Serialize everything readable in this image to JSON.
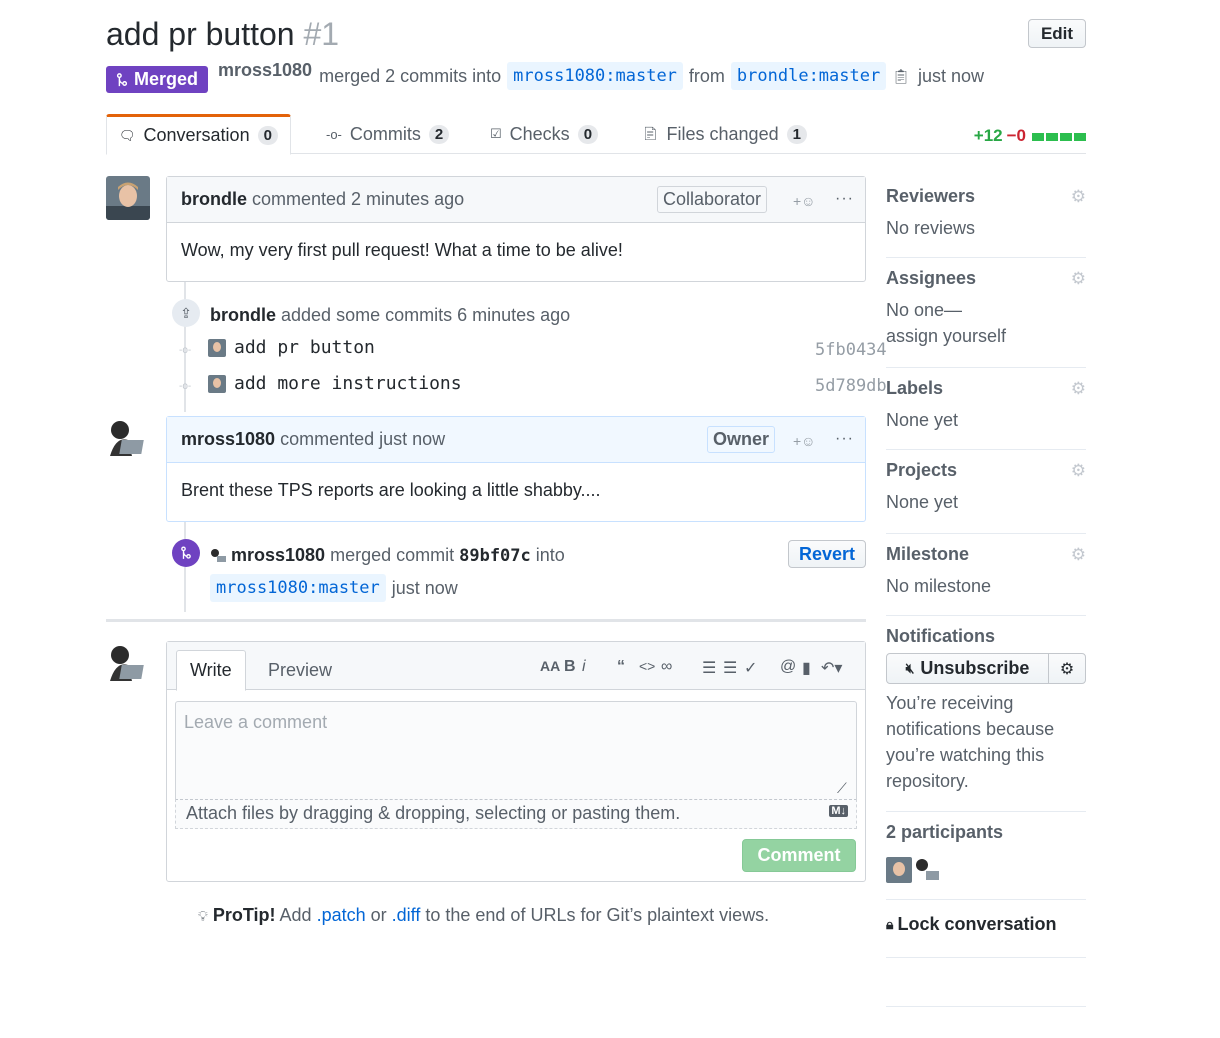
{
  "pr": {
    "title": "add pr button",
    "number": "#1",
    "edit_label": "Edit",
    "state_label": "Merged",
    "merger": "mross1080",
    "merged_text": "merged 2 commits into",
    "base_branch": "mross1080:master",
    "from_text": "from",
    "head_branch": "brondle:master",
    "time": "just now"
  },
  "tabs": [
    {
      "label": "Conversation",
      "count": "0"
    },
    {
      "label": "Commits",
      "count": "2"
    },
    {
      "label": "Checks",
      "count": "0"
    },
    {
      "label": "Files changed",
      "count": "1"
    }
  ],
  "diffstat": {
    "additions": "+12",
    "deletions": "−0"
  },
  "comment1": {
    "author": "brondle",
    "meta": "commented 2 minutes ago",
    "role": "Collaborator",
    "body": "Wow, my very first pull request! What a time to be alive!"
  },
  "commits_event": {
    "author": "brondle",
    "meta": "added some commits 6 minutes ago",
    "commits": [
      {
        "message": "add pr button",
        "sha": "5fb0434"
      },
      {
        "message": "add more instructions",
        "sha": "5d789db"
      }
    ]
  },
  "comment2": {
    "author": "mross1080",
    "meta": "commented just now",
    "role": "Owner",
    "body": "Brent these TPS reports are looking a little shabby...."
  },
  "merge_event": {
    "author": "mross1080",
    "text": "merged commit",
    "sha": "89bf07c",
    "into": "into",
    "branch": "mross1080:master",
    "time": "just now",
    "revert_label": "Revert"
  },
  "composer": {
    "write_tab": "Write",
    "preview_tab": "Preview",
    "placeholder": "Leave a comment",
    "attach_text": "Attach files by dragging & dropping, selecting or pasting them.",
    "submit_label": "Comment"
  },
  "protip": {
    "label": "ProTip!",
    "pre": "Add",
    "patch": ".patch",
    "or": "or",
    "diff": ".diff",
    "post": "to the end of URLs for Git’s plaintext views."
  },
  "sidebar": {
    "reviewers": {
      "title": "Reviewers",
      "value": "No reviews"
    },
    "assignees": {
      "title": "Assignees",
      "value_line1": "No one—",
      "value_line2": "assign yourself"
    },
    "labels": {
      "title": "Labels",
      "value": "None yet"
    },
    "projects": {
      "title": "Projects",
      "value": "None yet"
    },
    "milestone": {
      "title": "Milestone",
      "value": "No milestone"
    },
    "notifications": {
      "title": "Notifications",
      "button": "Unsubscribe",
      "reason": [
        "You’re receiving",
        "notifications because",
        "you’re watching this",
        "repository."
      ]
    },
    "participants": {
      "title": "2 participants"
    },
    "lock": "Lock conversation"
  },
  "colors": {
    "merged": "#6f42c1",
    "link": "#0366d6",
    "addition": "#28a745",
    "deletion": "#cb2431"
  }
}
